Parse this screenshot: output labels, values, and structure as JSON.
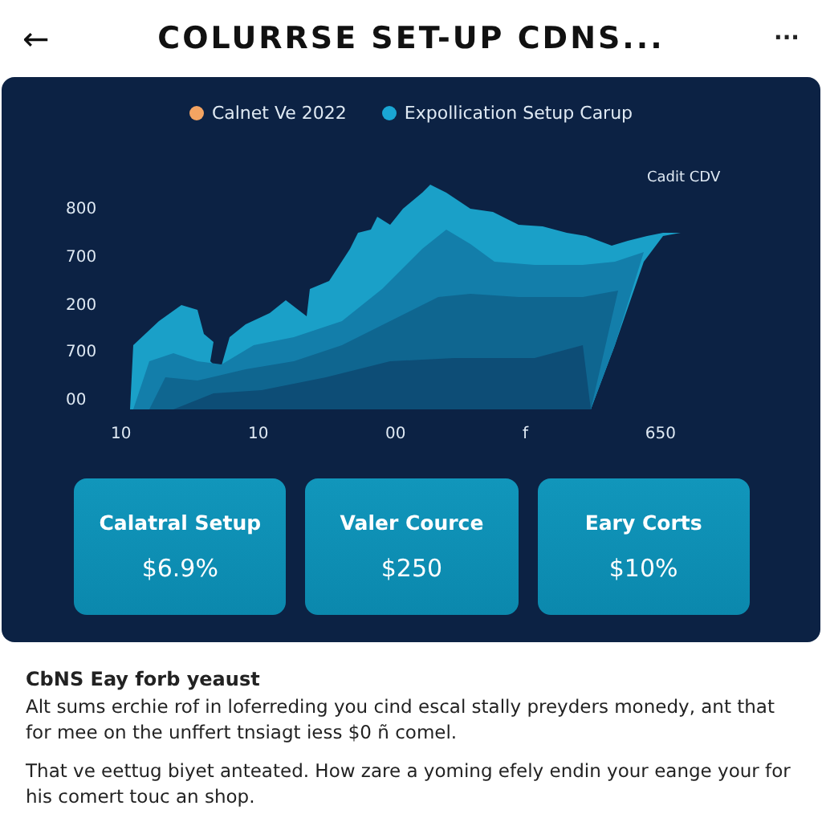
{
  "header": {
    "back_icon": "←",
    "title": "COLURRSE SET-UP CDNS...",
    "more_icon": "···"
  },
  "chart": {
    "legend": [
      {
        "label": "Calnet Ve 2022",
        "color": "#f4a462"
      },
      {
        "label": "Expollication Setup Carup",
        "color": "#1aa6d4"
      }
    ],
    "y_labels": [
      "800",
      "700",
      "200",
      "700",
      "00"
    ],
    "x_labels": [
      "10",
      "10",
      "00",
      "f",
      "650"
    ],
    "end_label": "Cadit CDV"
  },
  "cards": [
    {
      "label": "Calatral Setup",
      "value": "$6.9%"
    },
    {
      "label": "Valer Cource",
      "value": "$250"
    },
    {
      "label": "Eary Corts",
      "value": "$10%"
    }
  ],
  "article": {
    "heading": "CbNS Eay forb yeaust",
    "paragraphs": [
      "Alt sums erchie rof in loferreding you cind escal stally preyders monedy, ant that for mee on the unffert tnsiagt iess $0 ñ comel.",
      "That ve eettug biyet anteated. How zare a yoming efely endin your eange your for his comert touc an shop."
    ]
  }
}
